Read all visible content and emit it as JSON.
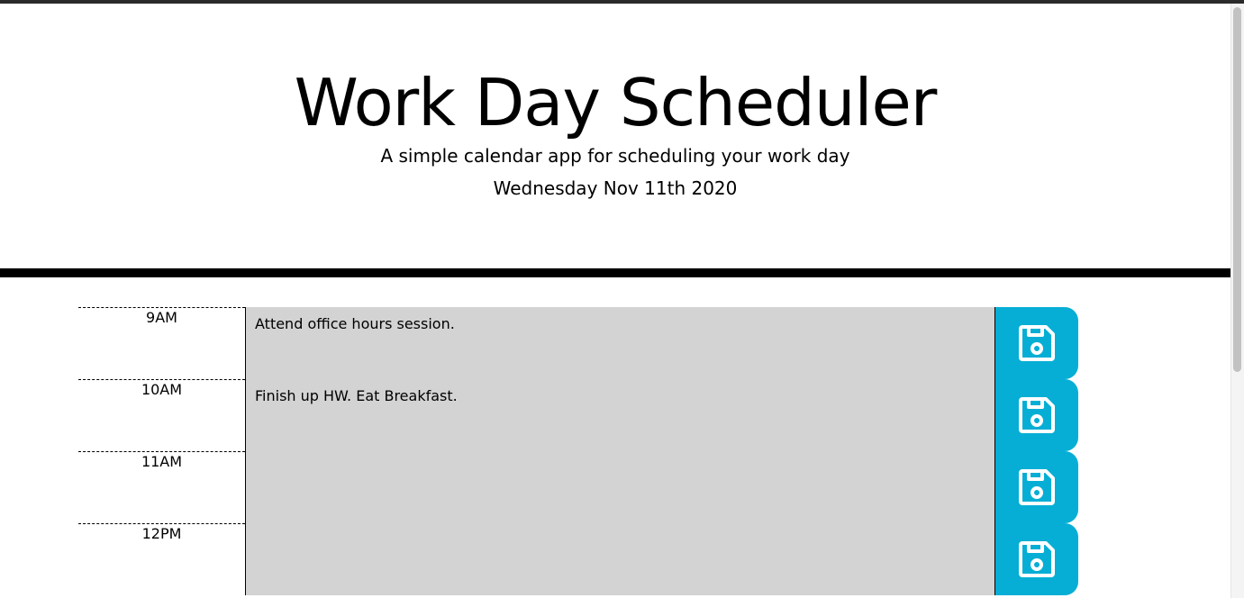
{
  "header": {
    "title": "Work Day Scheduler",
    "subtitle": "A simple calendar app for scheduling your work day",
    "current_day": "Wednesday Nov 11th 2020"
  },
  "colors": {
    "save_button": "#06aed5",
    "textarea_background": "#d3d3d3",
    "header_divider": "#000000"
  },
  "time_blocks": [
    {
      "hour": "9AM",
      "text": "Attend office hours session.",
      "save_icon": "floppy-disk-icon"
    },
    {
      "hour": "10AM",
      "text": "Finish up HW. Eat Breakfast.",
      "save_icon": "floppy-disk-icon"
    },
    {
      "hour": "11AM",
      "text": "",
      "save_icon": "floppy-disk-icon"
    },
    {
      "hour": "12PM",
      "text": "",
      "save_icon": "floppy-disk-icon"
    }
  ]
}
